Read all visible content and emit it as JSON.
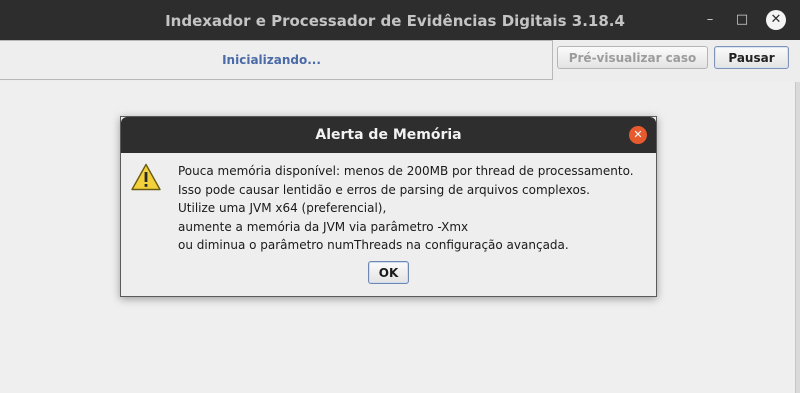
{
  "window": {
    "title": "Indexador e Processador de Evidências Digitais 3.18.4",
    "controls": {
      "minimize_glyph": "–",
      "maximize_glyph": "□",
      "close_glyph": "✕"
    }
  },
  "toolbar": {
    "progress_text": "Inicializando...",
    "preview_button": "Pré-visualizar caso",
    "pause_button": "Pausar"
  },
  "dialog": {
    "title": "Alerta de Memória",
    "close_glyph": "✕",
    "icon": "warning-icon",
    "message_lines": [
      "Pouca memória disponível: menos de 200MB por thread de processamento.",
      "Isso pode causar lentidão e erros de parsing de arquivos complexos.",
      "Utilize uma JVM x64 (preferencial),",
      "aumente a memória da JVM via parâmetro -Xmx",
      "ou diminua o parâmetro numThreads na configuração avançada."
    ],
    "ok_button": "OK"
  },
  "colors": {
    "titlebar": "#2d2d2d",
    "progress_text": "#4a6aa8",
    "dialog_close": "#e65a2e",
    "warning_fill": "#f2d13a"
  }
}
